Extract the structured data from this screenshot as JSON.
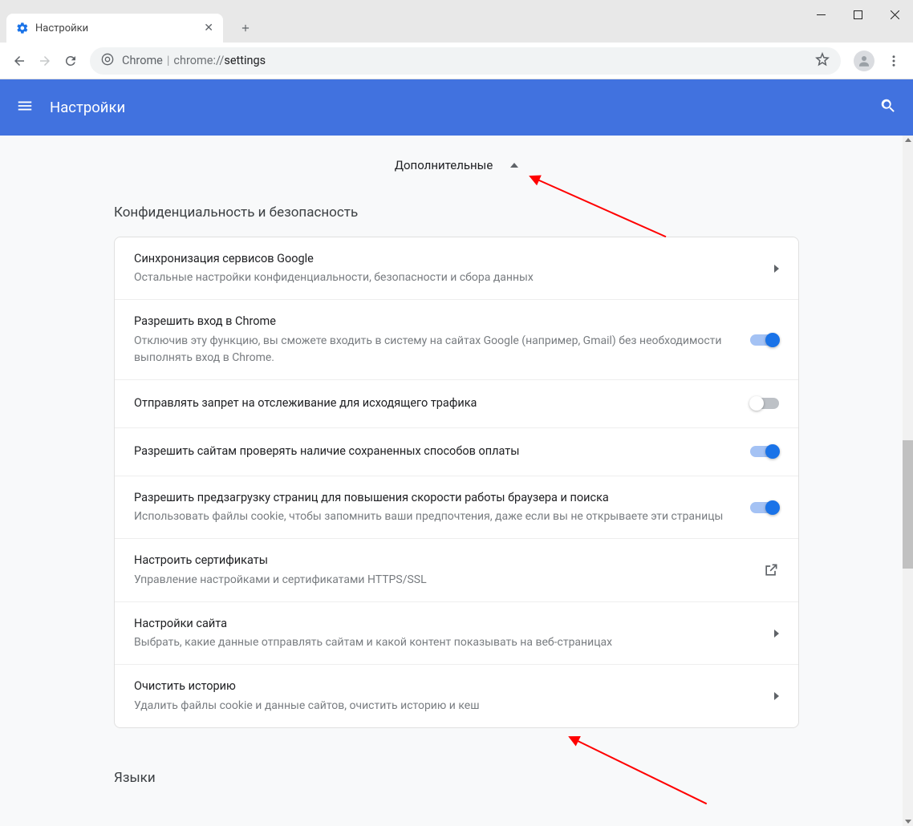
{
  "tab": {
    "title": "Настройки"
  },
  "omnibox": {
    "prefix": "Chrome",
    "path_gray": "chrome://",
    "path_dark": "settings"
  },
  "header": {
    "title": "Настройки"
  },
  "advanced_label": "Дополнительные",
  "section_privacy": "Конфиденциальность и безопасность",
  "rows": [
    {
      "title": "Синхронизация сервисов Google",
      "desc": "Остальные настройки конфиденциальности, безопасности и сбора данных",
      "action": "chevron"
    },
    {
      "title": "Разрешить вход в Chrome",
      "desc": "Отключив эту функцию, вы сможете входить в систему на сайтах Google (например, Gmail) без необходимости выполнять вход в Chrome.",
      "action": "toggle",
      "on": true
    },
    {
      "title": "Отправлять запрет на отслеживание для исходящего трафика",
      "desc": "",
      "action": "toggle",
      "on": false
    },
    {
      "title": "Разрешить сайтам проверять наличие сохраненных способов оплаты",
      "desc": "",
      "action": "toggle",
      "on": true
    },
    {
      "title": "Разрешить предзагрузку страниц для повышения скорости работы браузера и поиска",
      "desc": "Использовать файлы cookie, чтобы запомнить ваши предпочтения, даже если вы не открываете эти страницы",
      "action": "toggle",
      "on": true
    },
    {
      "title": "Настроить сертификаты",
      "desc": "Управление настройками и сертификатами HTTPS/SSL",
      "action": "external"
    },
    {
      "title": "Настройки сайта",
      "desc": "Выбрать, какие данные отправлять сайтам и какой контент показывать на веб-страницах",
      "action": "chevron"
    },
    {
      "title": "Очистить историю",
      "desc": "Удалить файлы cookie и данные сайтов, очистить историю и кеш",
      "action": "chevron"
    }
  ],
  "section_languages": "Языки"
}
